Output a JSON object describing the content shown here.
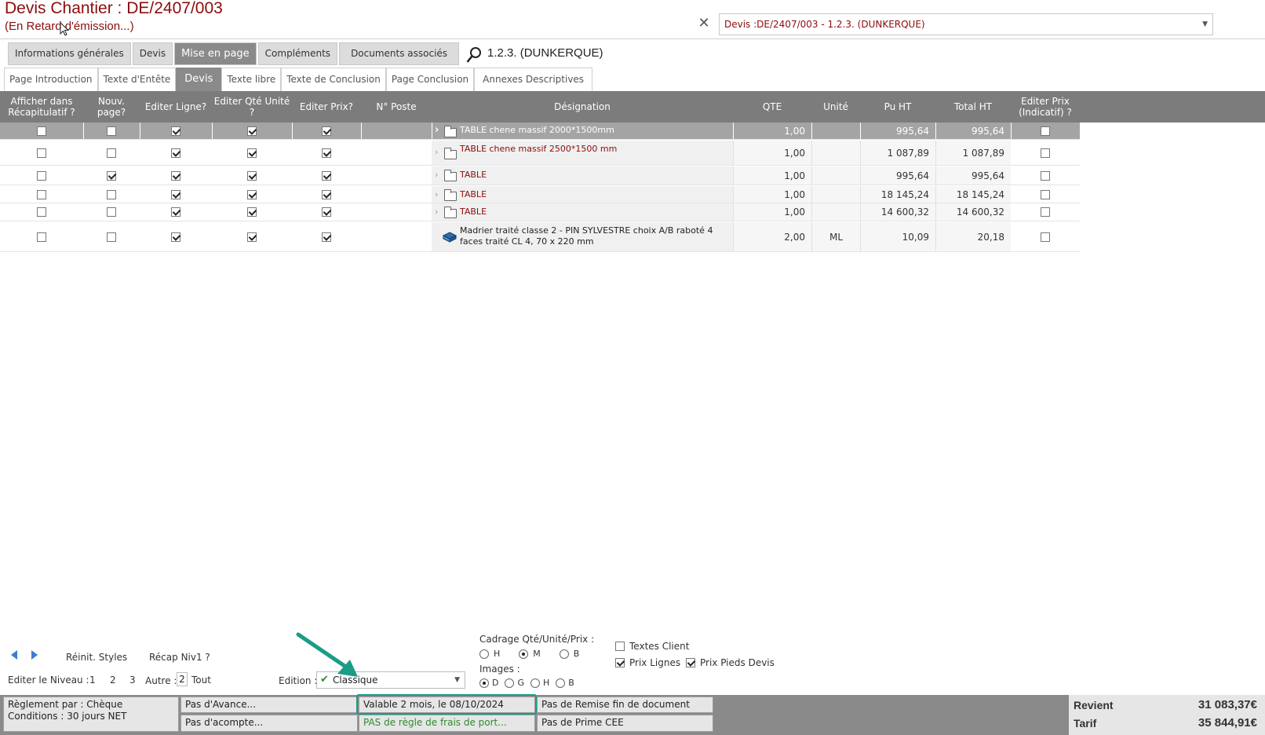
{
  "header": {
    "title": "Devis  Chantier : DE/2407/003",
    "subtitle": "(En Retard d'émission...)",
    "doc_select_value": "Devis :DE/2407/003 - 1.2.3.  (DUNKERQUE)"
  },
  "tabs_main": [
    {
      "label": "Informations générales",
      "active": false
    },
    {
      "label": "Devis",
      "active": false
    },
    {
      "label": "Mise en page",
      "active": true
    },
    {
      "label": "Compléments",
      "active": false
    },
    {
      "label": "Documents associés",
      "active": false
    }
  ],
  "search_text": "1.2.3.  (DUNKERQUE)",
  "tabs_sub": [
    {
      "label": "Page Introduction",
      "active": false
    },
    {
      "label": "Texte d'Entête",
      "active": false
    },
    {
      "label": "Devis",
      "active": true
    },
    {
      "label": "Texte libre",
      "active": false
    },
    {
      "label": "Texte de Conclusion",
      "active": false
    },
    {
      "label": "Page Conclusion",
      "active": false
    },
    {
      "label": "Annexes Descriptives",
      "active": false
    }
  ],
  "table": {
    "headers": {
      "afficher": "Afficher dans Récapitulatif ?",
      "nouv_page": "Nouv. page?",
      "editer_ligne": "Editer Ligne?",
      "editer_qte": "Editer Qté Unité ?",
      "editer_prix": "Editer Prix?",
      "n_poste": "N° Poste",
      "designation": "Désignation",
      "qte": "QTE",
      "unite": "Unité",
      "pu_ht": "Pu HT",
      "total_ht": "Total HT",
      "editer_prix_ind": "Editer Prix (Indicatif) ?"
    },
    "rows": [
      {
        "afficher": false,
        "nouv_page": false,
        "editer_ligne": true,
        "editer_qte": true,
        "editer_prix": true,
        "n_poste": "",
        "designation": "TABLE chene massif 2000*1500mm",
        "icon": "folder-icon",
        "qte": "1,00",
        "unite": "",
        "pu_ht": "995,64",
        "total_ht": "995,64",
        "editer_prix_ind": false,
        "selected": true
      },
      {
        "afficher": false,
        "nouv_page": false,
        "editer_ligne": true,
        "editer_qte": true,
        "editer_prix": true,
        "n_poste": "",
        "designation": "TABLE chene massif 2500*1500 mm",
        "icon": "folder-icon",
        "qte": "1,00",
        "unite": "",
        "pu_ht": "1 087,89",
        "total_ht": "1 087,89",
        "editer_prix_ind": false,
        "selected": false
      },
      {
        "afficher": false,
        "nouv_page": true,
        "editer_ligne": true,
        "editer_qte": true,
        "editer_prix": true,
        "n_poste": "",
        "designation": "TABLE",
        "icon": "folder-icon",
        "qte": "1,00",
        "unite": "",
        "pu_ht": "995,64",
        "total_ht": "995,64",
        "editer_prix_ind": false,
        "selected": false
      },
      {
        "afficher": false,
        "nouv_page": false,
        "editer_ligne": true,
        "editer_qte": true,
        "editer_prix": true,
        "n_poste": "",
        "designation": "TABLE",
        "icon": "folder-icon",
        "qte": "1,00",
        "unite": "",
        "pu_ht": "18 145,24",
        "total_ht": "18 145,24",
        "editer_prix_ind": false,
        "selected": false
      },
      {
        "afficher": false,
        "nouv_page": false,
        "editer_ligne": true,
        "editer_qte": true,
        "editer_prix": true,
        "n_poste": "",
        "designation": "TABLE",
        "icon": "folder-icon",
        "qte": "1,00",
        "unite": "",
        "pu_ht": "14 600,32",
        "total_ht": "14 600,32",
        "editer_prix_ind": false,
        "selected": false
      },
      {
        "afficher": false,
        "nouv_page": false,
        "editer_ligne": true,
        "editer_qte": true,
        "editer_prix": true,
        "n_poste": "",
        "designation": "Madrier traité classe 2 - PIN SYLVESTRE choix A/B raboté 4 faces traité CL 4, 70 x 220 mm",
        "icon": "article-icon",
        "qte": "2,00",
        "unite": "ML",
        "pu_ht": "10,09",
        "total_ht": "20,18",
        "editer_prix_ind": false,
        "selected": false
      }
    ]
  },
  "controls": {
    "reinit_styles": "Réinit. Styles",
    "recap_niv1": "Récap Niv1 ?",
    "editer_niveau": "Editer le Niveau :",
    "level_1": "1",
    "level_2": "2",
    "level_3": "3",
    "autre": "Autre :",
    "autre_value": "2",
    "tout": "Tout",
    "edition_label": "Edition :",
    "edition_value": "Classique",
    "cadrage_label": "Cadrage Qté/Unité/Prix :",
    "cadrage_options": [
      {
        "label": "H",
        "on": false
      },
      {
        "label": "M",
        "on": true
      },
      {
        "label": "B",
        "on": false
      }
    ],
    "images_label": "Images :",
    "images_options": [
      {
        "label": "D",
        "on": true
      },
      {
        "label": "G",
        "on": false
      },
      {
        "label": "H",
        "on": false
      },
      {
        "label": "B",
        "on": false
      }
    ],
    "textes_client": {
      "label": "Textes Client",
      "checked": false
    },
    "prix_lignes": {
      "label": "Prix Lignes",
      "checked": true
    },
    "prix_pieds": {
      "label": "Prix Pieds Devis",
      "checked": true
    }
  },
  "footer": {
    "reglement": "Règlement par : Chèque",
    "conditions": "Conditions : 30 jours NET",
    "avance": "Pas d'Avance...",
    "acompte": "Pas d'acompte...",
    "validite": "Valable 2 mois, le 08/10/2024",
    "frais_port": "PAS de règle de frais de port...",
    "remise": "Pas de Remise fin de document",
    "prime": "Pas de Prime CEE",
    "revient_label": "Revient",
    "revient_value": "31 083,37€",
    "tarif_label": "Tarif",
    "tarif_value": "35 844,91€"
  },
  "colors": {
    "accent_red": "#8b0d0d",
    "header_gray": "#7c7c7c",
    "highlight_teal": "#1a9c86",
    "green_text": "#2e8b2e"
  }
}
